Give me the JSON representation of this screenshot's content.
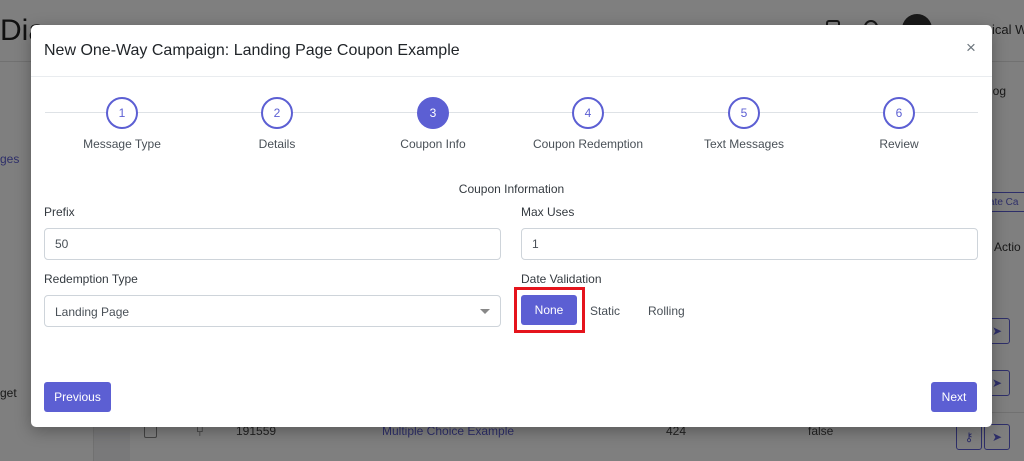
{
  "background": {
    "logo_fragment": "Dia",
    "user_name_fragment": "ical W",
    "sidebar_item_1": "ges",
    "sidebar_item_2": "get",
    "blog_fragment": "log",
    "create_fragment": "ate Ca",
    "actions_fragment": "Actio",
    "row": {
      "id": "191559",
      "name": "Multiple Choice Example",
      "count": "424",
      "flag": "false"
    }
  },
  "modal": {
    "title": "New One-Way Campaign: Landing Page Coupon Example",
    "close_glyph": "×",
    "steps": [
      {
        "number": "1",
        "label": "Message Type",
        "active": false
      },
      {
        "number": "2",
        "label": "Details",
        "active": false
      },
      {
        "number": "3",
        "label": "Coupon Info",
        "active": true
      },
      {
        "number": "4",
        "label": "Coupon Redemption",
        "active": false
      },
      {
        "number": "5",
        "label": "Text Messages",
        "active": false
      },
      {
        "number": "6",
        "label": "Review",
        "active": false
      }
    ],
    "section_title": "Coupon Information",
    "prefix": {
      "label": "Prefix",
      "value": "50"
    },
    "max_uses": {
      "label": "Max Uses",
      "value": "1"
    },
    "redemption_type": {
      "label": "Redemption Type",
      "value": "Landing Page"
    },
    "date_validation": {
      "label": "Date Validation",
      "options": [
        "None",
        "Static",
        "Rolling"
      ],
      "selected": "None"
    },
    "buttons": {
      "previous": "Previous",
      "next": "Next"
    }
  },
  "colors": {
    "accent": "#5c5fd3",
    "highlight": "#e5141c",
    "overlay": "rgba(0,0,0,0.5)"
  }
}
